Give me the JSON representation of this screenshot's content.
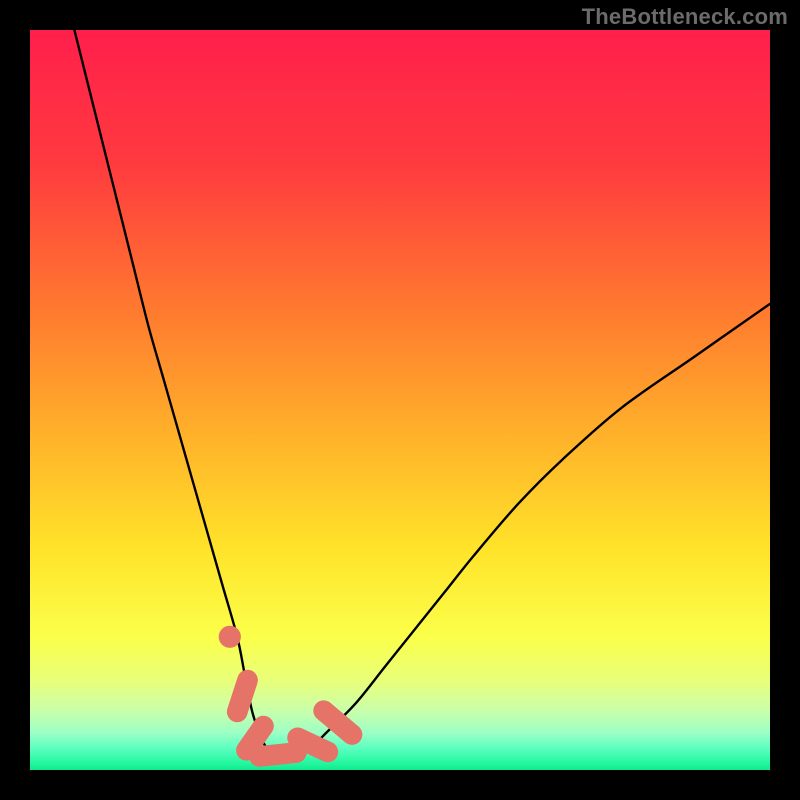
{
  "watermark": "TheBottleneck.com",
  "chart_data": {
    "type": "line",
    "title": "",
    "xlabel": "",
    "ylabel": "",
    "xlim": [
      0,
      100
    ],
    "ylim": [
      0,
      100
    ],
    "gradient_stops": [
      {
        "offset": 0,
        "color": "#ff1f4b"
      },
      {
        "offset": 18,
        "color": "#ff3a3f"
      },
      {
        "offset": 38,
        "color": "#ff7a2f"
      },
      {
        "offset": 55,
        "color": "#ffb22a"
      },
      {
        "offset": 70,
        "color": "#ffe329"
      },
      {
        "offset": 82,
        "color": "#fbff4a"
      },
      {
        "offset": 88,
        "color": "#e8ff7a"
      },
      {
        "offset": 92,
        "color": "#c9ffab"
      },
      {
        "offset": 95,
        "color": "#9cffc5"
      },
      {
        "offset": 97,
        "color": "#5dffc0"
      },
      {
        "offset": 99,
        "color": "#25f8a0"
      },
      {
        "offset": 100,
        "color": "#12e98f"
      }
    ],
    "series": [
      {
        "name": "bottleneck-curve",
        "x": [
          6,
          8,
          10,
          12,
          14,
          16,
          18,
          20,
          22,
          24,
          26,
          28,
          29,
          30,
          31,
          32,
          34,
          36,
          38,
          40,
          44,
          48,
          52,
          56,
          60,
          66,
          72,
          80,
          90,
          100
        ],
        "y": [
          100,
          92,
          84,
          76,
          68,
          60,
          53,
          46,
          39,
          32,
          25,
          18,
          13,
          8,
          5,
          3,
          2,
          2,
          3,
          5,
          9,
          14,
          19,
          24,
          29,
          36,
          42,
          49,
          56,
          63
        ]
      }
    ],
    "markers": [
      {
        "shape": "dot",
        "cx": 27.0,
        "cy": 18.0,
        "r": 1.5
      },
      {
        "shape": "capsule",
        "cx": 28.7,
        "cy": 10.0,
        "len": 4.5,
        "angle": 72
      },
      {
        "shape": "capsule",
        "cx": 30.4,
        "cy": 4.3,
        "len": 4.0,
        "angle": 55
      },
      {
        "shape": "capsule",
        "cx": 33.5,
        "cy": 2.1,
        "len": 5.0,
        "angle": 6
      },
      {
        "shape": "capsule",
        "cx": 38.2,
        "cy": 3.4,
        "len": 4.5,
        "angle": -25
      },
      {
        "shape": "capsule",
        "cx": 41.6,
        "cy": 6.4,
        "len": 5.0,
        "angle": -40
      }
    ],
    "marker_color": "#e57368"
  }
}
